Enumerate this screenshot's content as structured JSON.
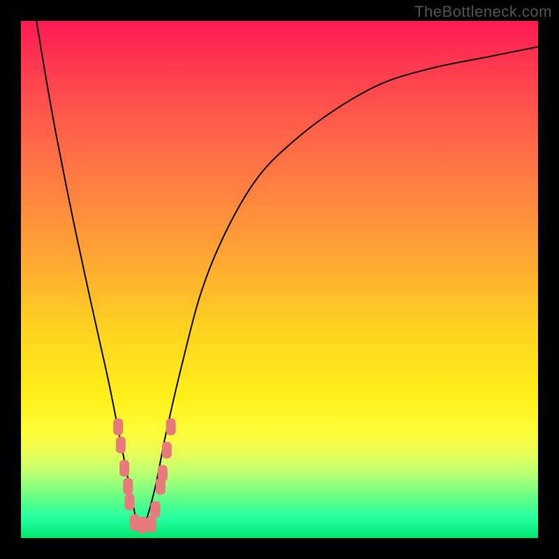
{
  "watermark": "TheBottleneck.com",
  "chart_data": {
    "type": "line",
    "title": "",
    "xlabel": "",
    "ylabel": "",
    "xlim": [
      0,
      100
    ],
    "ylim": [
      0,
      100
    ],
    "background_gradient": {
      "direction": "vertical",
      "stops": [
        {
          "pos": 0,
          "color": "#ff1a55"
        },
        {
          "pos": 8,
          "color": "#ff3750"
        },
        {
          "pos": 20,
          "color": "#ff5e49"
        },
        {
          "pos": 33,
          "color": "#ff8240"
        },
        {
          "pos": 46,
          "color": "#ffa733"
        },
        {
          "pos": 60,
          "color": "#ffd31f"
        },
        {
          "pos": 73,
          "color": "#fff019"
        },
        {
          "pos": 80,
          "color": "#fdfd3a"
        },
        {
          "pos": 84,
          "color": "#e4fd5a"
        },
        {
          "pos": 87,
          "color": "#c1ff6e"
        },
        {
          "pos": 90,
          "color": "#8eff7e"
        },
        {
          "pos": 93,
          "color": "#57ff8c"
        },
        {
          "pos": 96,
          "color": "#26ffa0"
        },
        {
          "pos": 100,
          "color": "#00e76f"
        }
      ]
    },
    "series": [
      {
        "name": "bottleneck-curve",
        "x": [
          3,
          5,
          7,
          10,
          13,
          15,
          17,
          19,
          21,
          22.5,
          24,
          26,
          28,
          31,
          35,
          40,
          46,
          53,
          61,
          70,
          80,
          90,
          100
        ],
        "y": [
          100,
          88,
          77,
          62,
          48,
          39,
          30,
          20,
          10,
          3,
          3,
          10,
          20,
          33,
          48,
          60,
          70,
          77,
          83,
          88,
          91,
          93,
          95
        ]
      }
    ],
    "markers": {
      "shape": "rounded-rect",
      "color": "#e77b7b",
      "points": [
        {
          "x": 18.8,
          "y": 21.5
        },
        {
          "x": 19.3,
          "y": 18.0
        },
        {
          "x": 20.0,
          "y": 13.5
        },
        {
          "x": 20.7,
          "y": 10.0
        },
        {
          "x": 21.0,
          "y": 7.0
        },
        {
          "x": 22.0,
          "y": 3.0
        },
        {
          "x": 23.5,
          "y": 2.5
        },
        {
          "x": 25.2,
          "y": 2.7
        },
        {
          "x": 26.0,
          "y": 5.5
        },
        {
          "x": 27.0,
          "y": 10.0
        },
        {
          "x": 27.4,
          "y": 12.5
        },
        {
          "x": 28.2,
          "y": 17.0
        },
        {
          "x": 29.0,
          "y": 21.5
        }
      ]
    }
  }
}
